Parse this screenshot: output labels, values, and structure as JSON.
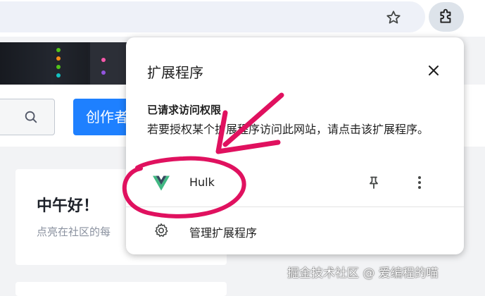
{
  "browser": {
    "bookmark_icon": "star-icon",
    "extensions_icon": "puzzle-icon"
  },
  "page": {
    "create_button_label": "创作者",
    "greeting": "中午好！",
    "greeting_sub": "点亮在社区的每"
  },
  "popup": {
    "title": "扩展程序",
    "requested_heading": "已请求访问权限",
    "requested_desc": "若要授权某个扩展程序访问此网站，请点击该扩展程序。",
    "extension": {
      "name": "Hulk",
      "icon": "vue-logo-icon"
    },
    "manage_label": "管理扩展程序"
  },
  "watermark": "掘金技术社区 @ 爱编程的喵",
  "colors": {
    "accent": "#1e80ff",
    "annotation": "#e0115f",
    "vue_green": "#41b883",
    "vue_dark": "#35495e"
  }
}
